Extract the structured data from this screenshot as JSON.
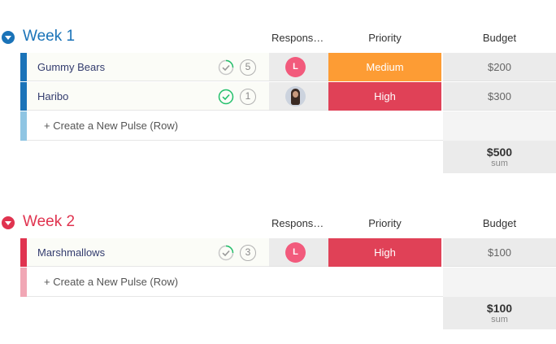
{
  "columns": {
    "responsible": "Respons…",
    "priority": "Priority",
    "budget": "Budget"
  },
  "add_row_label": "+ Create a New Pulse (Row)",
  "sum_label": "sum",
  "groups": [
    {
      "title": "Week 1",
      "color": "#1a73b8",
      "add_bar_color": "#8fc5e3",
      "sum": "$500",
      "pulses": [
        {
          "name": "Gummy Bears",
          "count": "5",
          "status": "in-progress",
          "owner_initial": "L",
          "owner_color": "#f25a7c",
          "priority": "Medium",
          "priority_color": "#fd9c34",
          "budget": "$200"
        },
        {
          "name": "Haribo",
          "count": "1",
          "status": "done",
          "owner_initial": "",
          "owner_color": "#ccd3de",
          "priority": "High",
          "priority_color": "#e04157",
          "budget": "$300"
        }
      ]
    },
    {
      "title": "Week 2",
      "color": "#e0334f",
      "add_bar_color": "#f1a7b5",
      "sum": "$100",
      "pulses": [
        {
          "name": "Marshmallows",
          "count": "3",
          "status": "in-progress",
          "owner_initial": "L",
          "owner_color": "#f25a7c",
          "priority": "High",
          "priority_color": "#e04157",
          "budget": "$100"
        }
      ]
    }
  ]
}
